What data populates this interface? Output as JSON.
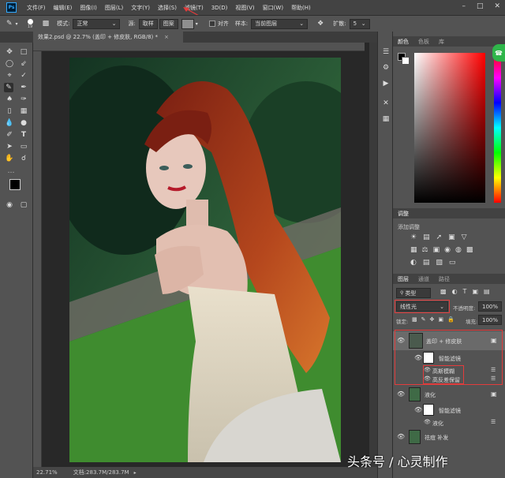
{
  "app": {
    "logo": "Ps"
  },
  "menu": [
    "文件(F)",
    "编辑(E)",
    "图像(I)",
    "图层(L)",
    "文字(Y)",
    "选择(S)",
    "滤镜(T)",
    "3D(D)",
    "视图(V)",
    "窗口(W)",
    "帮助(H)"
  ],
  "options": {
    "brush_size": "19",
    "mode_label": "模式:",
    "mode_value": "正常",
    "source_label": "源:",
    "sample_btn": "取样",
    "pattern_btn": "图案",
    "aligned_label": "对齐",
    "sample_label": "样本:",
    "sample_value": "当前图层",
    "diffusion_label": "扩散:",
    "diffusion_value": "5"
  },
  "document": {
    "tab_title": "效果2.psd @ 22.7% (盖印 + 修皮肤, RGB/8) *"
  },
  "status": {
    "zoom": "22.71%",
    "doc_size": "文档:283.7M/283.7M"
  },
  "panels": {
    "color_tabs": [
      "颜色",
      "色板",
      "库"
    ],
    "adjust_tabs": [
      "调整"
    ],
    "adjust_title": "添加调整",
    "layer_tabs": [
      "图层",
      "通道",
      "路径"
    ],
    "kind_label": "类型",
    "blend_mode": "线性光",
    "opacity_label": "不透明度:",
    "opacity_value": "100%",
    "lock_label": "锁定:",
    "fill_label": "填充:",
    "fill_value": "100%"
  },
  "layers": [
    {
      "name": "盖印 + 修皮肤",
      "selected": true
    },
    {
      "name": "智能滤镜",
      "type": "filter-mask"
    },
    {
      "name": "高斯模糊",
      "type": "filter"
    },
    {
      "name": "高反差保留",
      "type": "filter"
    },
    {
      "name": "液化"
    },
    {
      "name": "智能滤镜",
      "type": "filter-mask"
    },
    {
      "name": "液化",
      "type": "filter"
    },
    {
      "name": "祛痘 补发"
    }
  ],
  "watermark": "头条号 / 心灵制作",
  "colors": {
    "accent_red": "#e23c3c",
    "ps_blue": "#31a8ff",
    "panel_bg": "#535353"
  }
}
